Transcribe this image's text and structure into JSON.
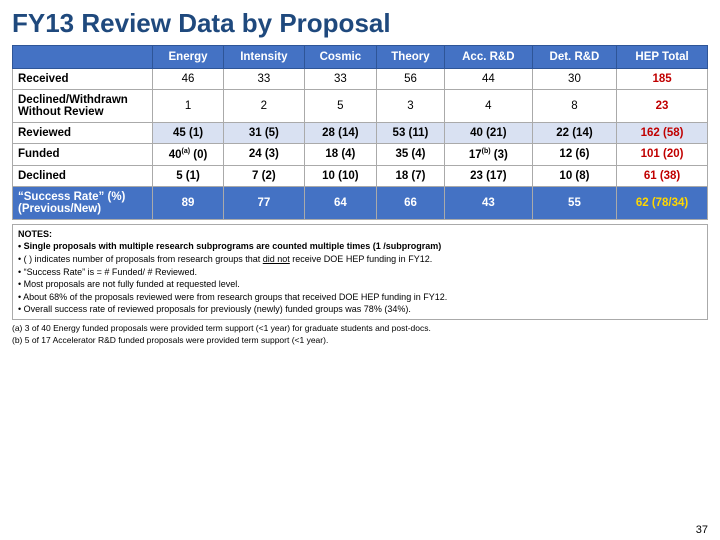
{
  "title": "FY13 Review Data by Proposal",
  "table": {
    "headers": [
      "",
      "Energy",
      "Intensity",
      "Cosmic",
      "Theory",
      "Acc. R&D",
      "Det. R&D",
      "HEP Total"
    ],
    "rows": [
      {
        "id": "received",
        "label": "Received",
        "values": [
          "46",
          "33",
          "33",
          "56",
          "44",
          "30"
        ],
        "hep_total": "185",
        "class": "row-received"
      },
      {
        "id": "declined-withdrawn",
        "label": "Declined/Withdrawn Without Review",
        "values": [
          "1",
          "2",
          "5",
          "3",
          "4",
          "8"
        ],
        "hep_total": "23",
        "class": "row-declined-withdrawn"
      },
      {
        "id": "reviewed",
        "label": "Reviewed",
        "values": [
          "45 (1)",
          "31 (5)",
          "28 (14)",
          "53 (11)",
          "40 (21)",
          "22 (14)"
        ],
        "hep_total": "162 (58)",
        "class": "row-reviewed"
      },
      {
        "id": "funded",
        "label": "Funded",
        "values": [
          "40(a) (0)",
          "24 (3)",
          "18 (4)",
          "35 (4)",
          "17(b) (3)",
          "12 (6)"
        ],
        "hep_total": "101 (20)",
        "class": "row-funded"
      },
      {
        "id": "declined",
        "label": "Declined",
        "values": [
          "5 (1)",
          "7 (2)",
          "10 (10)",
          "18 (7)",
          "23 (17)",
          "10 (8)"
        ],
        "hep_total": "61 (38)",
        "class": "row-declined"
      },
      {
        "id": "success",
        "label": "“Success Rate” (%) (Previous/New)",
        "values": [
          "89",
          "77",
          "64",
          "66",
          "43",
          "55"
        ],
        "hep_total": "62 (78/34)",
        "class": "row-success"
      }
    ]
  },
  "notes": {
    "title": "NOTES:",
    "lines": [
      "• Single proposals with multiple research subprograms are counted multiple times (1 /subprogram)",
      "• ( ) indicates number of proposals from research groups that did not receive DOE HEP funding in FY12.",
      "• “Success Rate” is = # Funded/ # Reviewed.",
      "• Most proposals are not fully funded at requested level.",
      "• About 68% of the proposals reviewed were from research groups that received DOE HEP funding in FY12.",
      "• Overall success rate of reviewed proposals for previously (newly) funded groups was 78% (34%)."
    ]
  },
  "footnotes": [
    "(a) 3 of 40 Energy funded proposals were provided term support (<1 year) for graduate students and post-docs.",
    "(b) 5 of 17 Accelerator R&D funded proposals were provided term support (<1 year)."
  ],
  "page_number": "37"
}
